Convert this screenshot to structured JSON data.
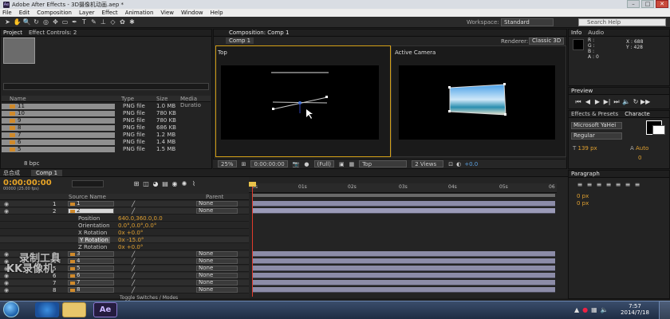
{
  "window": {
    "title": "Adobe After Effects - 3D摄像机动画.aep *"
  },
  "menu": [
    "File",
    "Edit",
    "Composition",
    "Layer",
    "Effect",
    "Animation",
    "View",
    "Window",
    "Help"
  ],
  "workspace": {
    "label": "Workspace:",
    "value": "Standard",
    "search_placeholder": "Search Help"
  },
  "project": {
    "tab": "Project",
    "effect_controls_tab": "Effect Controls: 2",
    "columns": [
      "Name",
      "Type",
      "Size",
      "Media Duratio"
    ],
    "files": [
      {
        "name": "11",
        "type": "PNG file",
        "size": "1.0 MB"
      },
      {
        "name": "10",
        "type": "PNG file",
        "size": "780 KB"
      },
      {
        "name": "9",
        "type": "PNG file",
        "size": "780 KB"
      },
      {
        "name": "8",
        "type": "PNG file",
        "size": "686 KB"
      },
      {
        "name": "7",
        "type": "PNG file",
        "size": "1.2 MB"
      },
      {
        "name": "6",
        "type": "PNG file",
        "size": "1.4 MB"
      },
      {
        "name": "5",
        "type": "PNG file",
        "size": "1.5 MB"
      }
    ],
    "bpc": "8 bpc"
  },
  "composition": {
    "tab": "Composition: Comp 1",
    "subtab": "Comp 1",
    "renderer_label": "Renderer:",
    "renderer": "Classic 3D",
    "view_left": "Top",
    "view_right": "Active Camera",
    "zoom": "25%",
    "timecode": "0:00:00:00",
    "resolution": "(Full)",
    "view_select": "Top",
    "views": "2 Views",
    "exposure": "+0.0"
  },
  "timeline": {
    "tabs": [
      "总合成",
      "Comp 1"
    ],
    "timecode": "0:00:00:00",
    "fps": "00000 (25.00 fps)",
    "col_source": "Source Name",
    "col_parent": "Parent",
    "ruler": [
      "0s",
      "01s",
      "02s",
      "03s",
      "04s",
      "05s",
      "06"
    ],
    "layers_top": [
      {
        "num": "1",
        "name": "1",
        "parent": "None"
      },
      {
        "num": "2",
        "name": "2",
        "parent": "None"
      }
    ],
    "properties": [
      {
        "name": "Position",
        "value": "640.0,360.0,0.0"
      },
      {
        "name": "Orientation",
        "value": "0.0°,0.0°,0.0°"
      },
      {
        "name": "X Rotation",
        "value": "0x +0.0°"
      },
      {
        "name": "Y Rotation",
        "value": "0x -15.0°"
      },
      {
        "name": "Z Rotation",
        "value": "0x +0.0°"
      }
    ],
    "layers_bottom": [
      {
        "num": "3",
        "name": "3",
        "parent": "None"
      },
      {
        "num": "4",
        "name": "4",
        "parent": "None"
      },
      {
        "num": "5",
        "name": "5",
        "parent": "None"
      },
      {
        "num": "6",
        "name": "6",
        "parent": "None"
      },
      {
        "num": "7",
        "name": "7",
        "parent": "None"
      },
      {
        "num": "8",
        "name": "8",
        "parent": "None"
      }
    ],
    "toggle": "Toggle Switches / Modes"
  },
  "info": {
    "tab": "Info",
    "audio_tab": "Audio",
    "r": "R :",
    "g": "G :",
    "b": "B :",
    "a": "A : 0",
    "x": "X : 688",
    "y": "Y : 428"
  },
  "preview": {
    "tab": "Preview"
  },
  "effects": {
    "tab": "Effects & Presets",
    "character_tab": "Characte"
  },
  "character": {
    "font": "Microsoft YaHei",
    "style": "Regular",
    "size": "139 px",
    "leading": "Auto",
    "kern": "0"
  },
  "paragraph": {
    "tab": "Paragraph",
    "indent": "0 px"
  },
  "watermark": [
    "录制工具",
    "KK录像机"
  ],
  "taskbar": {
    "time": "7:57",
    "date": "2014/7/18",
    "ae_label": "Ae"
  }
}
